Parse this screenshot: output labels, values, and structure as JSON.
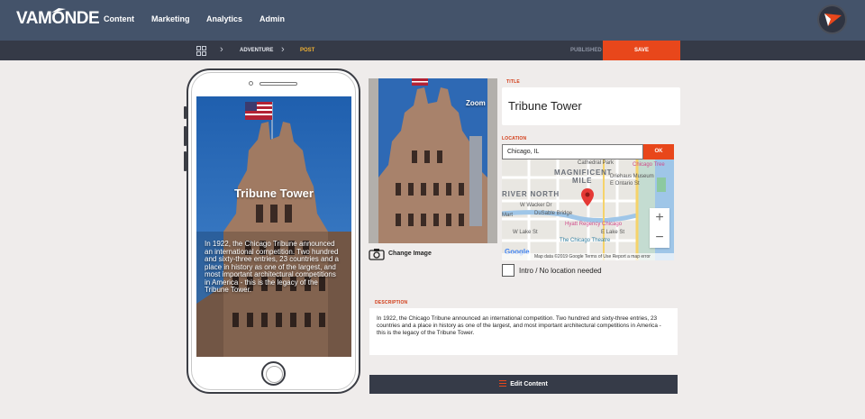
{
  "brand": {
    "logo_text": "VAMONDE"
  },
  "nav": {
    "items": [
      "Content",
      "Marketing",
      "Analytics",
      "Admin"
    ]
  },
  "breadcrumb": {
    "items": [
      "ADVENTURE",
      "POST"
    ]
  },
  "toolbar": {
    "status": "PUBLISHED",
    "save_label": "SAVE"
  },
  "phone_preview": {
    "title": "Tribune Tower",
    "description": "In 1922, the Chicago Tribune announced an international competition. Two hundred and sixty-three entries, 23 countries and a place in history as one of the largest, and most important architectural competitions in America - this is the legacy of the Tribune Tower."
  },
  "image": {
    "zoom_label": "Zoom",
    "change_label": "Change Image"
  },
  "form": {
    "title_label": "TITLE",
    "title_value": "Tribune Tower",
    "location_label": "LOCATION",
    "location_value": "Chicago, IL",
    "ok_label": "OK",
    "intro_label": "Intro / No location needed",
    "description_label": "DESCRIPTION",
    "description_value": "In 1922, the Chicago Tribune announced an international competition. Two hundred and sixty-three entries, 23 countries and a place in history as one of the largest, and most important architectural competitions in America - this is the legacy of the Tribune Tower.",
    "edit_label": "Edit Content"
  },
  "map": {
    "labels": [
      "Cathedral Park",
      "MAGNIFICENT",
      "MILE",
      "Chicago Tree",
      "Driehaus Museum",
      "E Ontario St",
      "RIVER NORTH",
      "W Wacker Dr",
      "DuSable Bridge",
      "Mart",
      "Hyatt Regency Chicago",
      "The Chicago Theatre",
      "W Lake St",
      "E Lake St"
    ],
    "footer": "Map data ©2019 Google   Terms of Use   Report a map error",
    "google": "Google"
  },
  "colors": {
    "nav_bg": "#44536a",
    "subbar_bg": "#353a47",
    "accent": "#e8471b",
    "page_bg": "#efeceb"
  }
}
